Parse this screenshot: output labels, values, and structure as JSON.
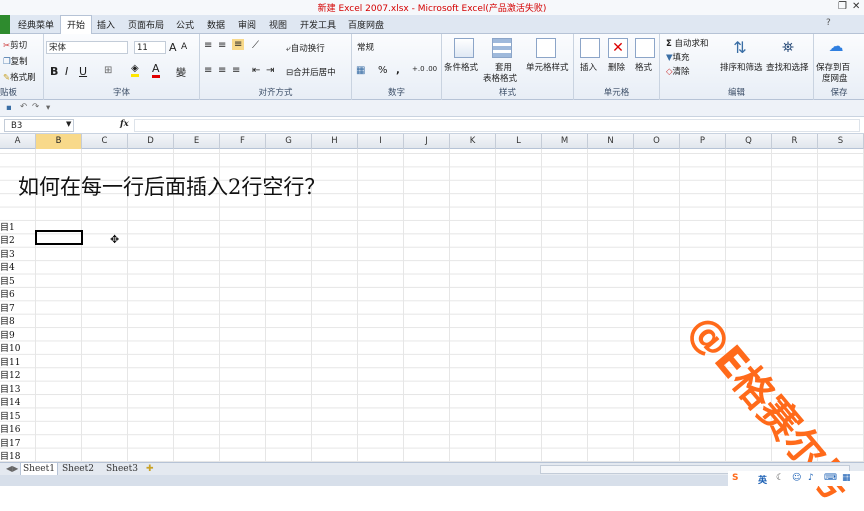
{
  "window": {
    "title": "新建 Excel 2007.xlsx - Microsoft Excel(产品激活失败)"
  },
  "menu": {
    "items": [
      "经典菜单",
      "开始",
      "插入",
      "页面布局",
      "公式",
      "数据",
      "审阅",
      "视图",
      "开发工具",
      "百度网盘"
    ]
  },
  "ribbon": {
    "clipboard": {
      "cut": "剪切",
      "copy": "复制",
      "format_painter": "格式刷",
      "label": "贴板"
    },
    "font": {
      "name": "宋体",
      "size": "11",
      "label": "字体",
      "bold": "B",
      "italic": "I",
      "underline": "U"
    },
    "align": {
      "wrap": "自动换行",
      "merge": "合并后居中",
      "label": "对齐方式"
    },
    "number": {
      "format": "常规",
      "percent": "%",
      "comma": ",",
      "label": "数字"
    },
    "styles": {
      "cond": "条件格式",
      "table1": "套用",
      "table2": "表格格式",
      "cell": "单元格样式",
      "label": "样式"
    },
    "cells": {
      "insert": "插入",
      "delete": "删除",
      "format": "格式",
      "label": "单元格"
    },
    "editing": {
      "autosum": "自动求和",
      "fill": "填充",
      "clear": "清除",
      "sort": "排序和筛选",
      "find": "查找和选择",
      "label": "编辑"
    },
    "save": {
      "line1": "保存到百",
      "line2": "度网盘",
      "label": "保存"
    }
  },
  "formula": {
    "namebox": "B3",
    "fx": "fx"
  },
  "columns": [
    "A",
    "B",
    "C",
    "D",
    "E",
    "F",
    "G",
    "H",
    "I",
    "J",
    "K",
    "L",
    "M",
    "N",
    "O",
    "P",
    "Q",
    "R",
    "S"
  ],
  "selected_column": "B",
  "sheet": {
    "question": "如何在每一行后面插入2行空行？",
    "rows": [
      "目1",
      "目2",
      "目3",
      "目4",
      "目5",
      "目6",
      "目7",
      "目8",
      "目9",
      "目10",
      "目11",
      "目12",
      "目13",
      "目14",
      "目15",
      "目16",
      "目17",
      "目18"
    ]
  },
  "tabs": [
    "Sheet1",
    "Sheet2",
    "Sheet3"
  ],
  "watermark": "@E格赛尔号",
  "tray": {
    "ime": "英"
  }
}
